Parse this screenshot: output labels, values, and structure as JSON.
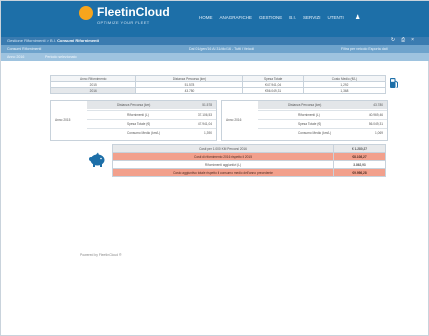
{
  "header": {
    "logo_text": "FleetinCloud",
    "logo_sub": "OPTIMIZE YOUR FLEET",
    "nav": [
      "HOME",
      "ANAGRAFICHE",
      "GESTIONE",
      "B.I.",
      "SERVIZI",
      "UTENTI"
    ],
    "user_icon": "user-icon"
  },
  "breadcrumb": {
    "path": "Gestione Rifornimenti  >  B.I.",
    "current": "Consumi Rifornimenti",
    "icons": [
      "refresh-icon",
      "print-icon",
      "close-icon"
    ]
  },
  "subbar": {
    "left": "Consumi Rifornimenti",
    "center": "Dal 01/gen/16 Al 31/dic/16 - Tutti i Veicoli",
    "right": "Filtra per veicolo   Esporta dati"
  },
  "infobar": {
    "left": "Anno 2016",
    "mid": "Periodo selezionato"
  },
  "summary_table": {
    "headers": [
      "Anno Rifornimento",
      "Distanza Percorsa (km)",
      "Spesa Totale",
      "Costo Medio (€/L)"
    ],
    "rows": [
      [
        "2015",
        "51.578",
        "€47.941,04",
        "1,292"
      ],
      [
        "2016",
        "43.780",
        "€56.049,31",
        "1,368"
      ]
    ]
  },
  "compare_left": {
    "label": "Anno 2015",
    "header": "Distanza Percorsa (km)",
    "header_value": "51.578",
    "rows": [
      {
        "label": "Rifornimenti (L)",
        "value": "37.106,53"
      },
      {
        "label": "Spesa Totale (€)",
        "value": "47.941,04"
      },
      {
        "label": "Consumo Medio (km/L)",
        "value": "1,390"
      }
    ]
  },
  "compare_right": {
    "label": "Anno 2016",
    "header": "Distanza Percorsa (km)",
    "header_value": "43.780",
    "rows": [
      {
        "label": "Rifornimenti (L)",
        "value": "40.969,46"
      },
      {
        "label": "Spesa Totale (€)",
        "value": "56.049,31"
      },
      {
        "label": "Consumo Medio (km/L)",
        "value": "1,069"
      }
    ]
  },
  "cost_table": {
    "header_left": "Costi per 1.000 KM Percorsi 2016",
    "header_right": "€ 1.280,27",
    "rows": [
      {
        "label": "Costi di rifornimento 2016 rispetto il 2015",
        "value": "€8.108,27",
        "highlight": true
      },
      {
        "label": "Rifornimenti aggiuntivi (L)",
        "value": "3.862,93",
        "highlight": false
      },
      {
        "label": "Costo aggiuntivo totale rispetto il consumo medio dell'anno precedente",
        "value": "€9.956,28",
        "highlight": true
      }
    ]
  },
  "footer": {
    "note": "Powered by FleetInCloud ®"
  },
  "colors": {
    "topbar": "#1d6fa8",
    "accent": "#f7a51c",
    "highlight_row": "#f2a08c"
  }
}
